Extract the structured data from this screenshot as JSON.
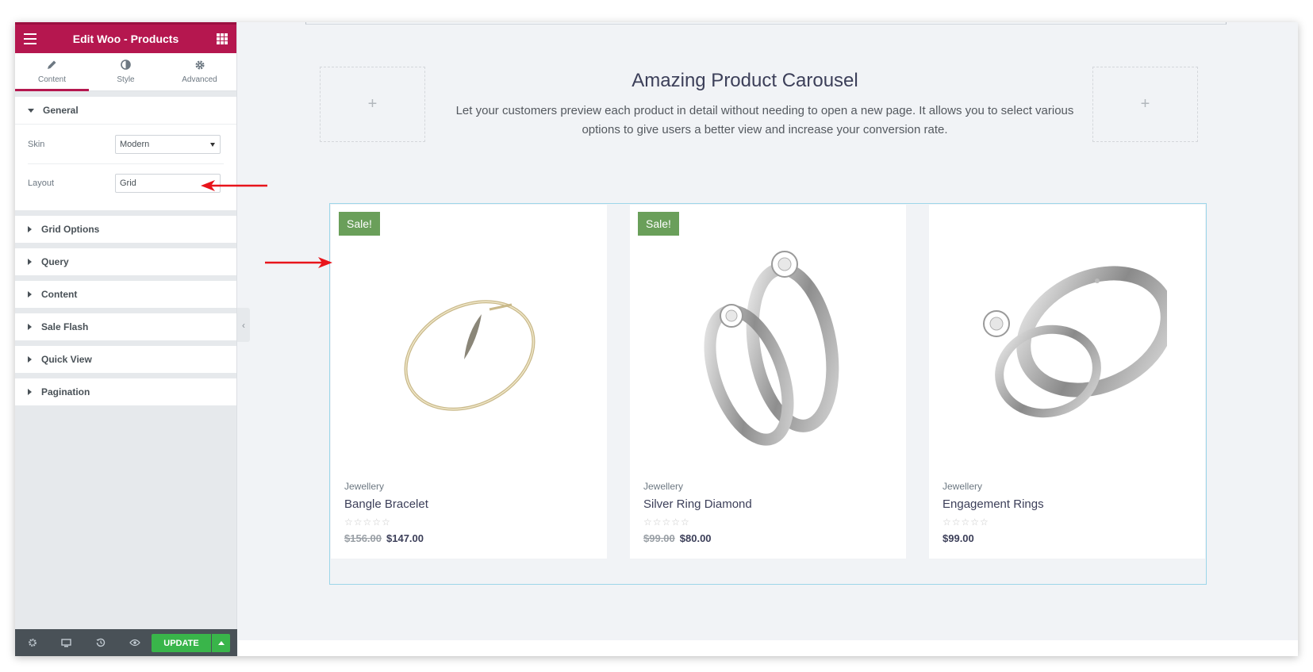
{
  "panel": {
    "title": "Edit Woo - Products",
    "tabs": [
      {
        "label": "Content",
        "icon": "pencil-icon"
      },
      {
        "label": "Style",
        "icon": "contrast-icon"
      },
      {
        "label": "Advanced",
        "icon": "gear-icon"
      }
    ],
    "general": {
      "label": "General",
      "skin_label": "Skin",
      "skin_value": "Modern",
      "layout_label": "Layout",
      "layout_value": "Grid"
    },
    "sections": [
      "Grid Options",
      "Query",
      "Content",
      "Sale Flash",
      "Quick View",
      "Pagination"
    ],
    "footer": {
      "update_label": "UPDATE",
      "icons": [
        "settings-icon",
        "responsive-icon",
        "history-icon",
        "preview-icon"
      ]
    },
    "accent": "#b5174f"
  },
  "canvas": {
    "heading": "Amazing Product Carousel",
    "subtext": "Let your customers preview each product in detail without needing to open a new page. It allows you to select various options to give users a better view and increase your conversion rate.",
    "add_symbol": "+"
  },
  "products": [
    {
      "sale": "Sale!",
      "category": "Jewellery",
      "name": "Bangle Bracelet",
      "old_price": "$156.00",
      "price": "$147.00"
    },
    {
      "sale": "Sale!",
      "category": "Jewellery",
      "name": "Silver Ring Diamond",
      "old_price": "$99.00",
      "price": "$80.00"
    },
    {
      "sale": "",
      "category": "Jewellery",
      "name": "Engagement Rings",
      "old_price": "",
      "price": "$99.00"
    }
  ],
  "stars": "☆☆☆☆☆",
  "colors": {
    "sale_badge": "#6a9f5a",
    "update_button": "#39b54a",
    "annotation_arrow": "#e8141b"
  }
}
